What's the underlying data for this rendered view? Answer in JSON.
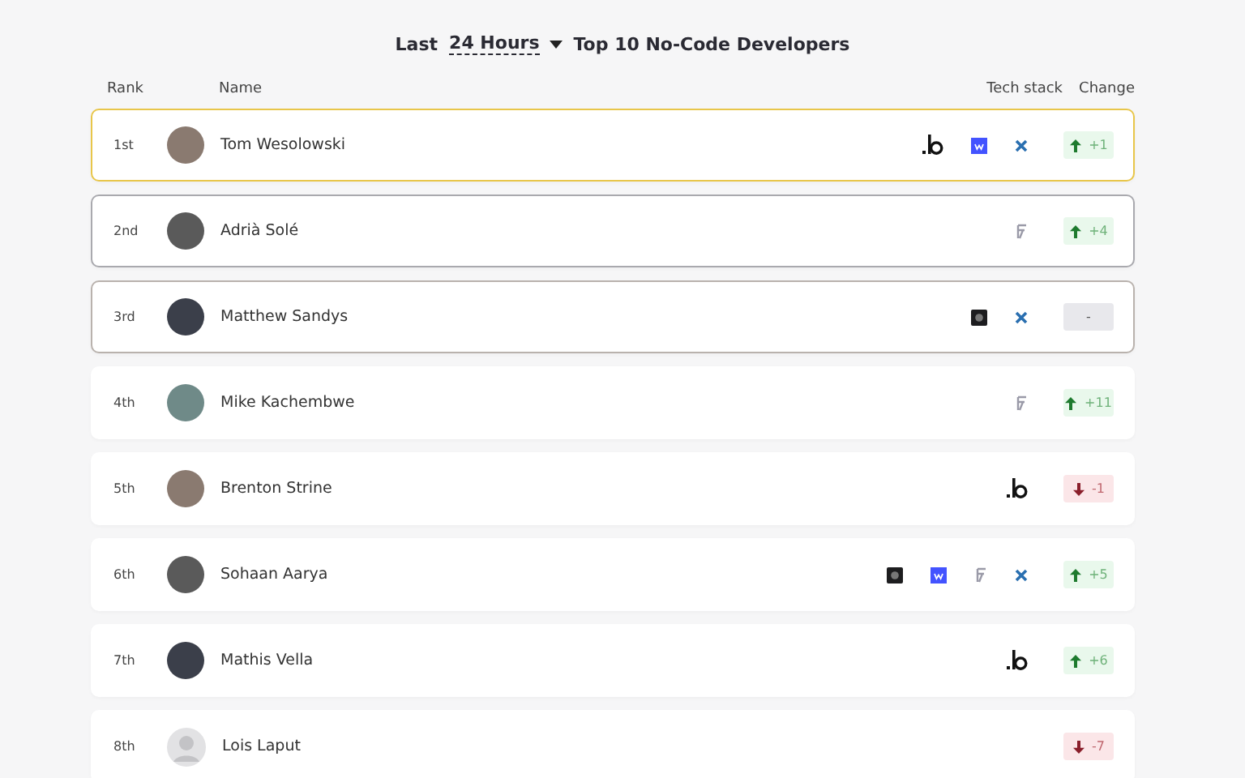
{
  "header": {
    "prefix": "Last",
    "period": "24 Hours",
    "title": "Top 10 No-Code Developers"
  },
  "columns": {
    "rank": "Rank",
    "name": "Name",
    "stack": "Tech stack",
    "change": "Change"
  },
  "rows": [
    {
      "rank": "1st",
      "name": "Tom Wesolowski",
      "color": "#e8c64a",
      "photo": true,
      "stack": [
        {
          "kind": "b"
        },
        {
          "kind": "square"
        },
        {
          "kind": "cross"
        }
      ],
      "change": {
        "kind": "up",
        "text": "+1"
      }
    },
    {
      "rank": "2nd",
      "name": "Adrià Solé",
      "color": "#a9a9ae",
      "photo": true,
      "stack": [
        {
          "kind": "glyph"
        }
      ],
      "change": {
        "kind": "up",
        "text": "+4"
      }
    },
    {
      "rank": "3rd",
      "name": "Matthew Sandys",
      "color": "#b9b2ad",
      "photo": true,
      "stack": [
        {
          "kind": "tile"
        },
        {
          "kind": "cross"
        }
      ],
      "change": {
        "kind": "none",
        "text": "-"
      }
    },
    {
      "rank": "4th",
      "name": "Mike Kachembwe",
      "color": "#ffffff",
      "photo": true,
      "stack": [
        {
          "kind": "glyph"
        }
      ],
      "change": {
        "kind": "up",
        "text": "+11"
      }
    },
    {
      "rank": "5th",
      "name": "Brenton Strine",
      "color": "#ffffff",
      "photo": true,
      "stack": [
        {
          "kind": "b"
        }
      ],
      "change": {
        "kind": "down",
        "text": "-1"
      }
    },
    {
      "rank": "6th",
      "name": "Sohaan Aarya",
      "color": "#ffffff",
      "photo": true,
      "stack": [
        {
          "kind": "tile"
        },
        {
          "kind": "square"
        },
        {
          "kind": "glyph"
        },
        {
          "kind": "cross"
        }
      ],
      "change": {
        "kind": "up",
        "text": "+5"
      }
    },
    {
      "rank": "7th",
      "name": "Mathis Vella",
      "color": "#ffffff",
      "photo": true,
      "stack": [
        {
          "kind": "b"
        }
      ],
      "change": {
        "kind": "up",
        "text": "+6"
      }
    },
    {
      "rank": "8th",
      "name": "Lois Laput",
      "color": "#ffffff",
      "photo": false,
      "stack": [],
      "change": {
        "kind": "down",
        "text": "-7"
      }
    }
  ]
}
